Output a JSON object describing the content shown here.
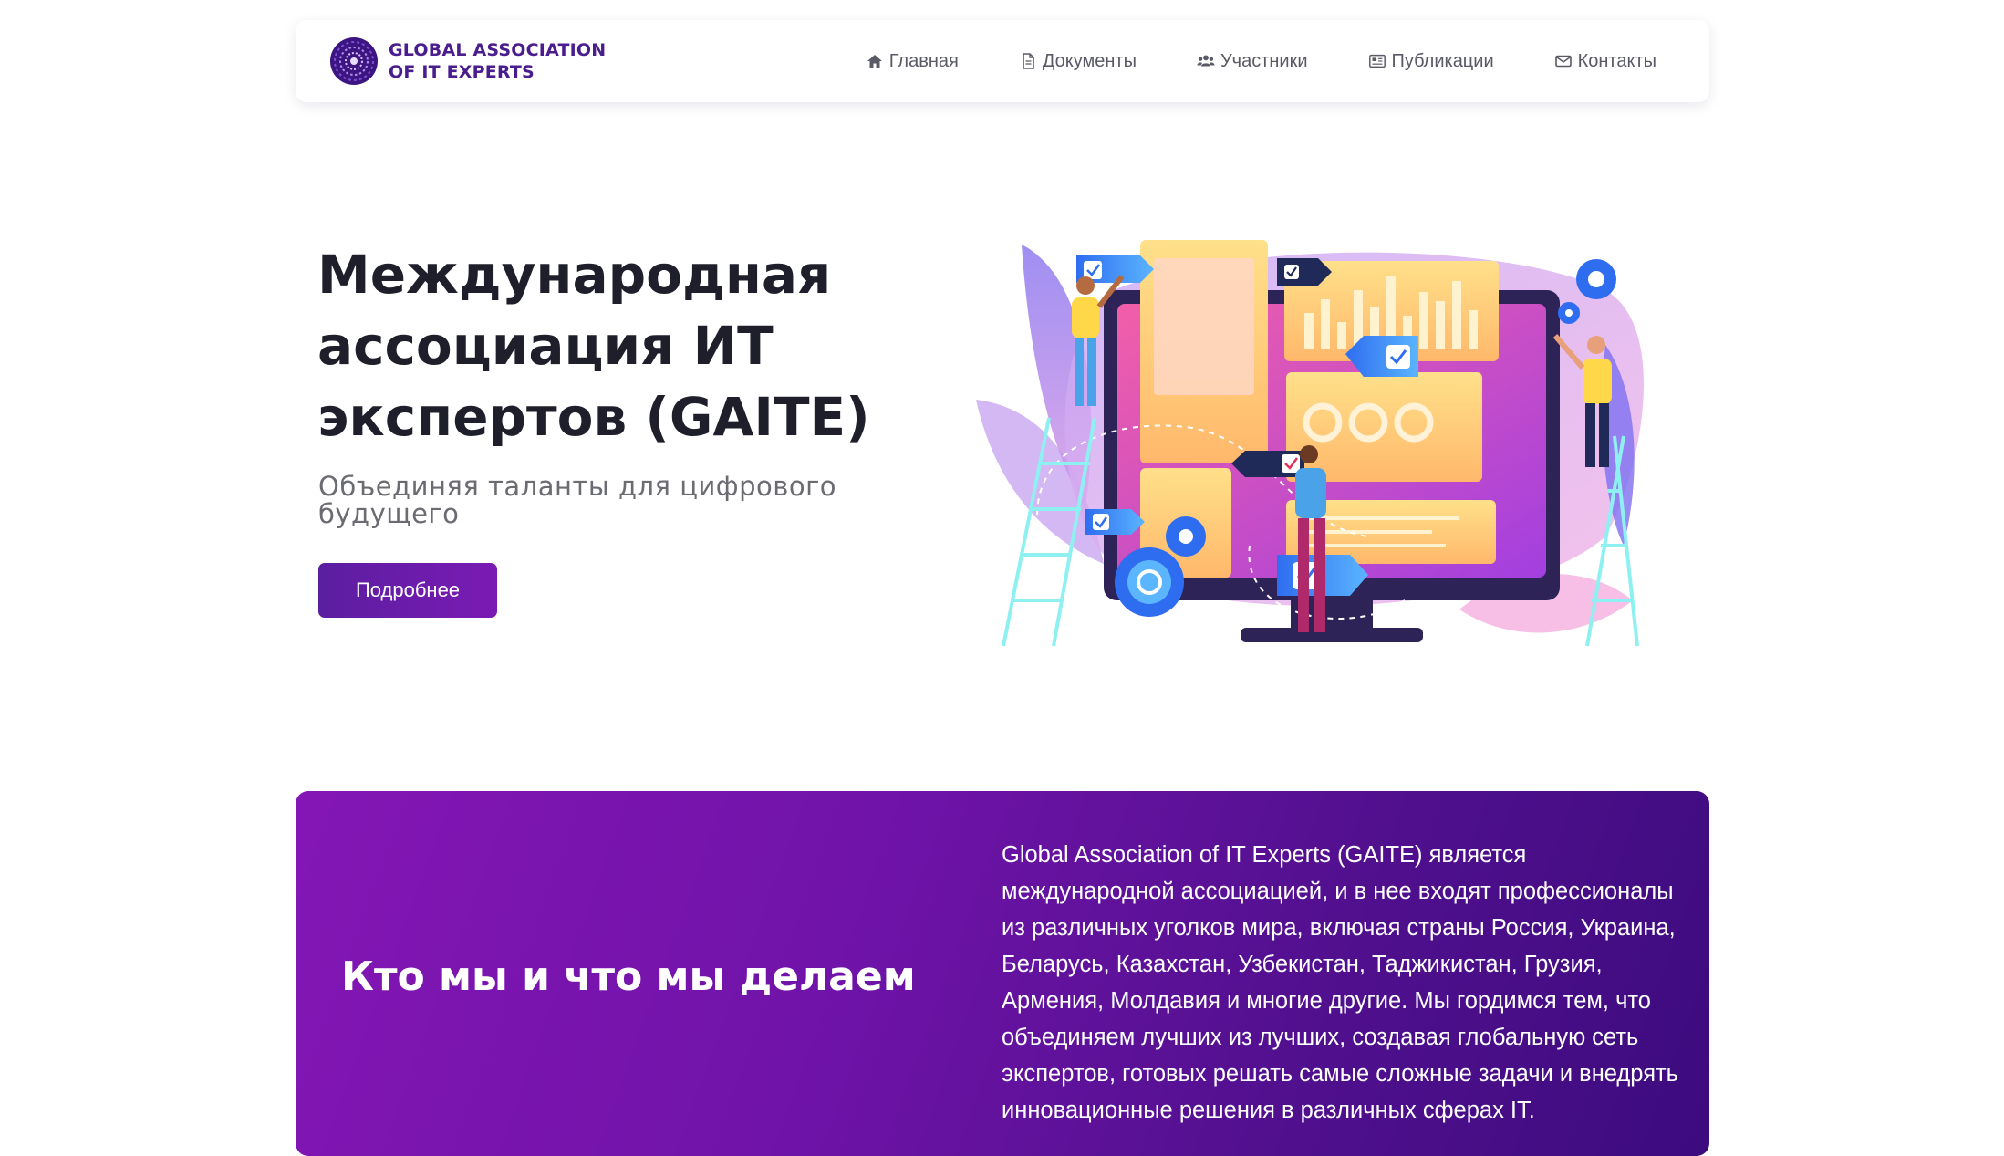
{
  "header": {
    "logo_line1": "GLOBAL ASSOCIATION",
    "logo_line2": "OF IT EXPERTS",
    "nav": [
      {
        "label": "Главная",
        "icon": "home-icon"
      },
      {
        "label": "Документы",
        "icon": "document-icon"
      },
      {
        "label": "Участники",
        "icon": "users-icon"
      },
      {
        "label": "Публикации",
        "icon": "newspaper-icon"
      },
      {
        "label": "Контакты",
        "icon": "envelope-icon"
      }
    ]
  },
  "hero": {
    "title": "Международная ассоциация ИТ экспертов (GAITE)",
    "subtitle": "Объединяя таланты для цифрового будущего",
    "button_label": "Подробнее",
    "illustration_icon": "team-dashboard-illustration"
  },
  "about": {
    "heading": "Кто мы и что мы делаем",
    "text": "Global Association of IT Experts (GAITE) является международной ассоциацией, и в нее входят профессионалы из различных уголков мира, включая страны Россия, Украина, Беларусь, Казахстан, Узбекистан, Таджикистан, Грузия, Армения, Молдавия и многие другие. Мы гордимся тем, что объединяем лучших из лучших, создавая глобальную сеть экспертов, готовых решать самые сложные задачи и внедрять инновационные решения в различных сферах IT."
  },
  "colors": {
    "brand_purple": "#4a1d8f",
    "button_gradient_start": "#5b1ea0",
    "button_gradient_end": "#7a1bb3",
    "section_gradient_start": "#8416b5",
    "section_gradient_end": "#3c0b7e"
  }
}
